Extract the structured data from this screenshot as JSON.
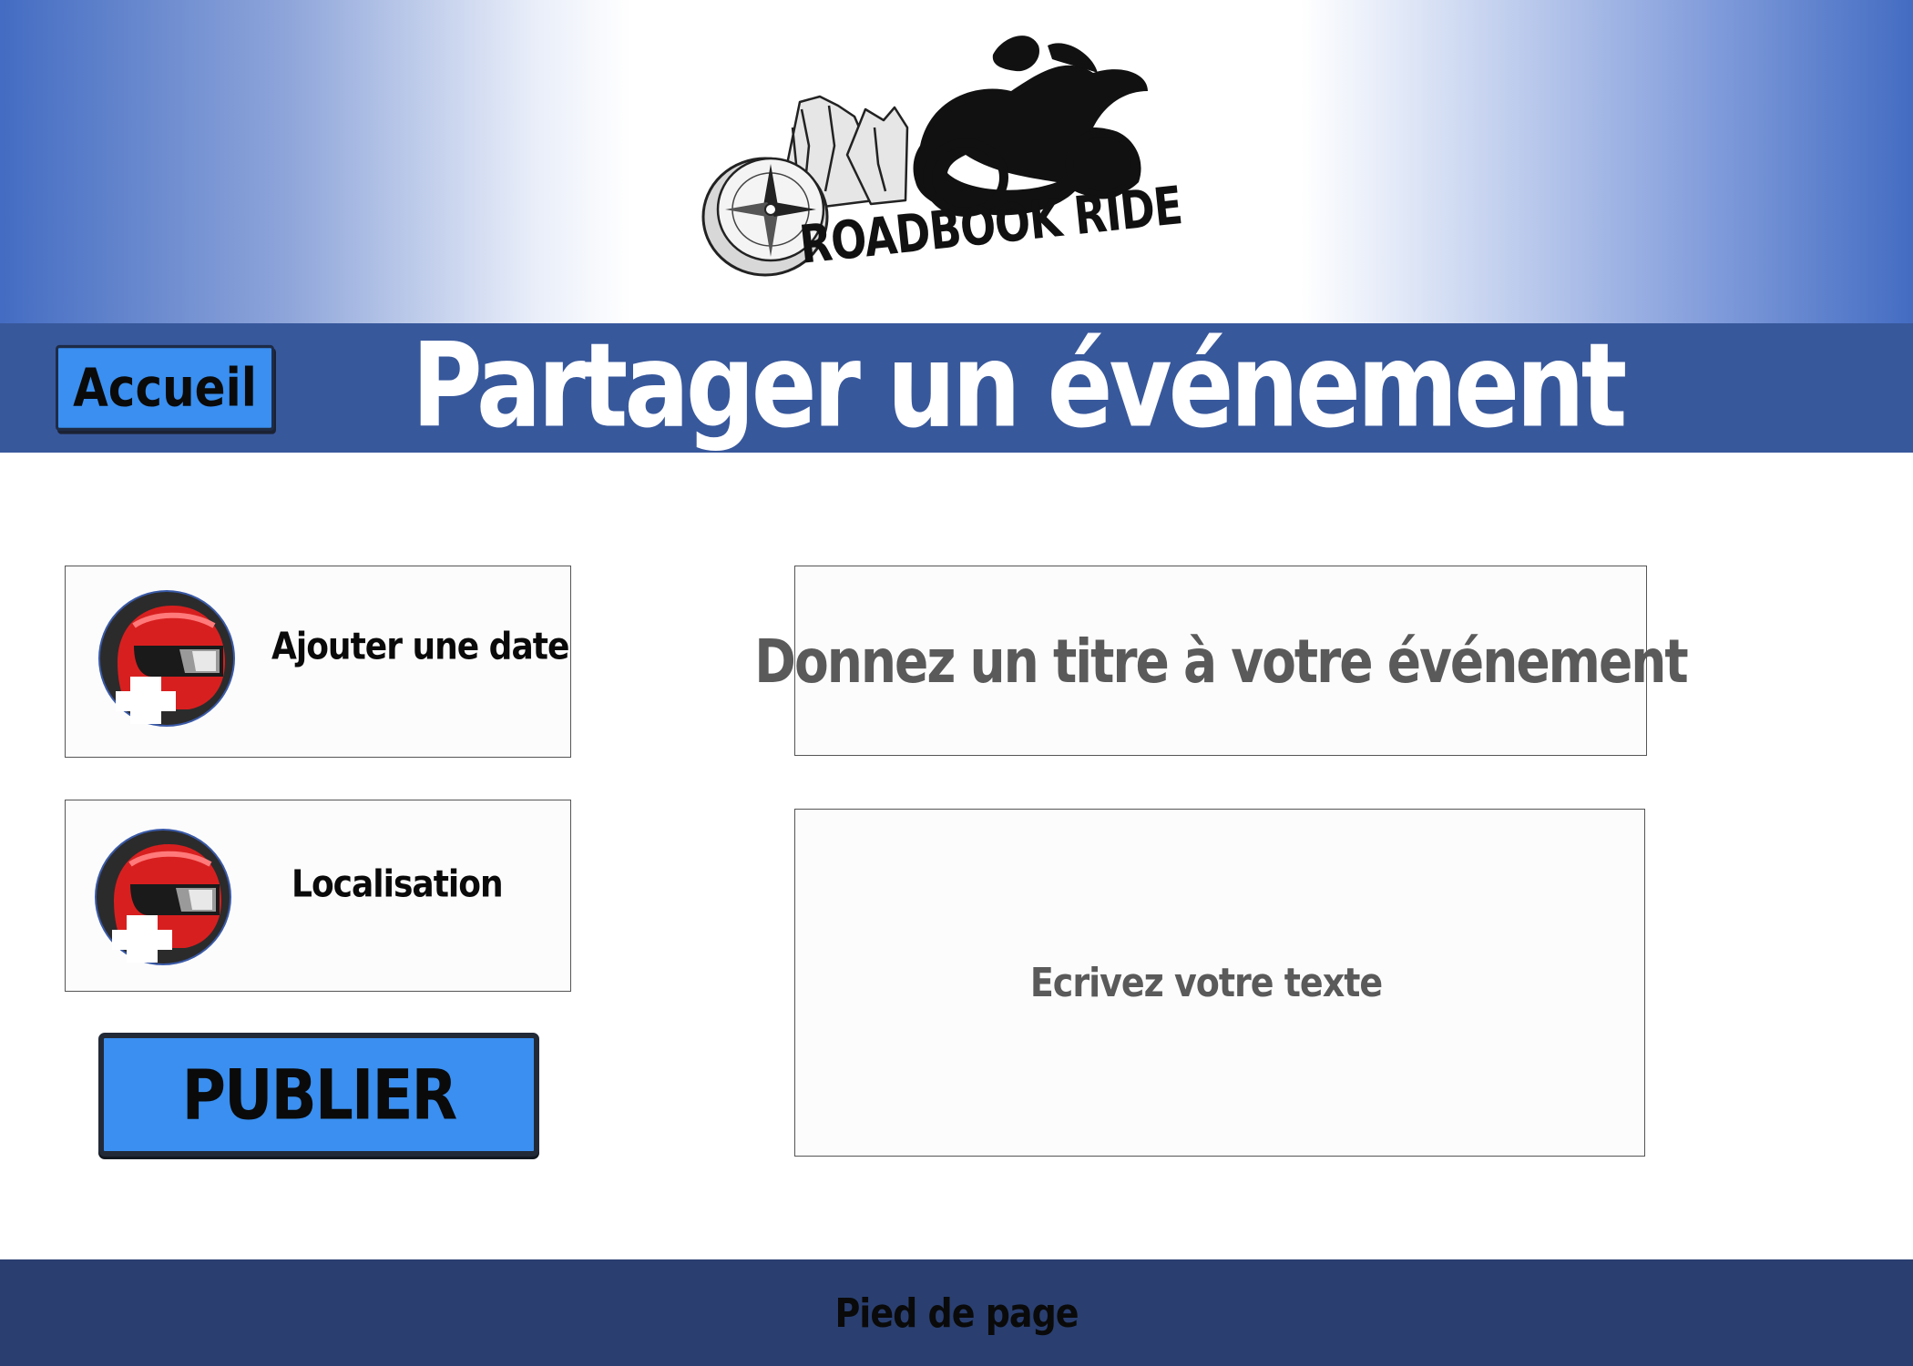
{
  "header": {
    "logo_text": "ROADBOOK RIDE",
    "logo_icon": "motorcycle-compass-mountains-logo",
    "gradient_edge_color": "#436cc2"
  },
  "titlebar": {
    "home_label": "Accueil",
    "title": "Partager un événement",
    "background_color": "#38589c"
  },
  "actions": {
    "add_date_label": "Ajouter une date",
    "location_label": "Localisation",
    "icon": "helmet-plus-icon",
    "publish_label": "PUBLIER",
    "button_color": "#3a8ff0"
  },
  "form": {
    "title_placeholder": "Donnez un titre à votre événement",
    "text_placeholder": "Ecrivez votre texte"
  },
  "footer": {
    "label": "Pied de page",
    "background_color": "#2a3f70"
  }
}
